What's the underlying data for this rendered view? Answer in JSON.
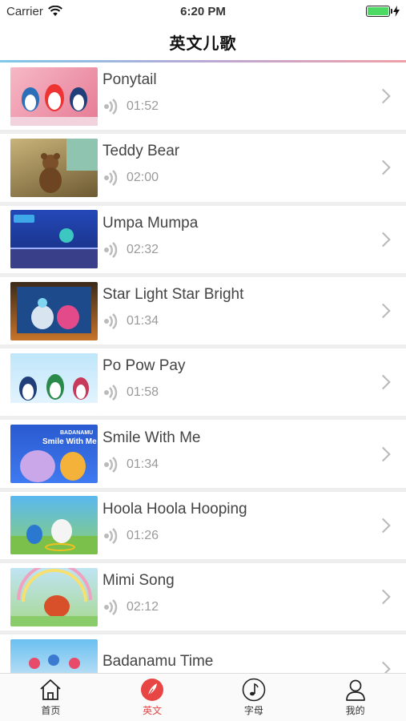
{
  "status": {
    "carrier": "Carrier",
    "time": "6:20 PM"
  },
  "nav": {
    "title": "英文儿歌"
  },
  "songs": [
    {
      "title": "Ponytail",
      "duration": "01:52"
    },
    {
      "title": "Teddy Bear",
      "duration": "02:00"
    },
    {
      "title": "Umpa Mumpa",
      "duration": "02:32"
    },
    {
      "title": "Star Light Star Bright",
      "duration": "01:34"
    },
    {
      "title": "Po Pow Pay",
      "duration": "01:58"
    },
    {
      "title": "Smile With Me",
      "duration": "01:34"
    },
    {
      "title": "Hoola Hoola Hooping",
      "duration": "01:26"
    },
    {
      "title": "Mimi Song",
      "duration": "02:12"
    },
    {
      "title": "Badanamu Time",
      "duration": ""
    }
  ],
  "tabs": [
    {
      "label": "首页",
      "icon": "home-icon"
    },
    {
      "label": "英文",
      "icon": "feather-icon",
      "active": true
    },
    {
      "label": "字母",
      "icon": "music-note-icon"
    },
    {
      "label": "我的",
      "icon": "person-icon"
    }
  ],
  "colors": {
    "accent": "#e84545",
    "battery": "#4cd964"
  },
  "thumbs": {
    "smile_with_me_overlay": [
      "BADANAMU",
      "Smile With Me"
    ]
  }
}
